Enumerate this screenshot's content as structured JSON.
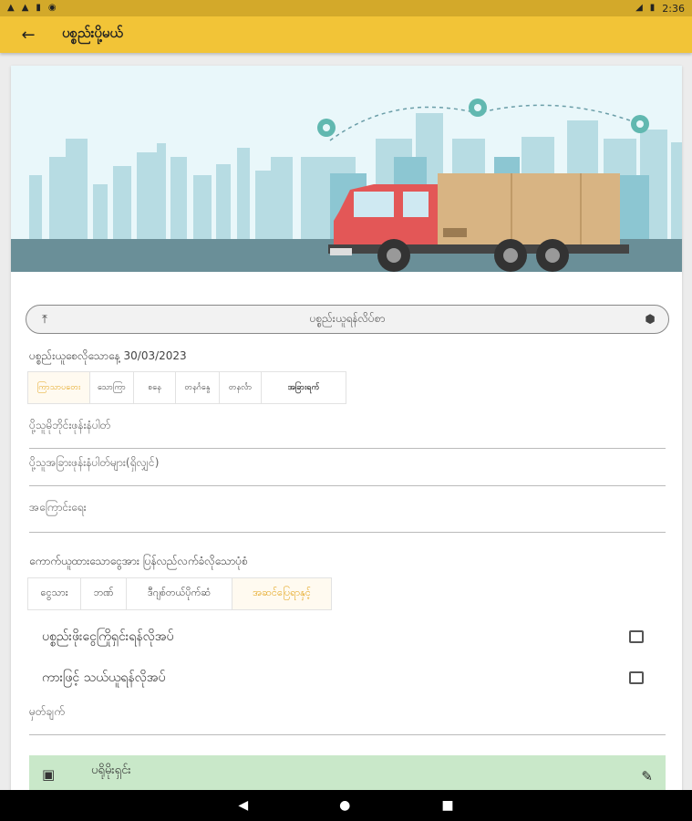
{
  "status_bar": {
    "time": "2:36"
  },
  "app_bar": {
    "title": "ပစ္စည်းပို့မယ်"
  },
  "upload": {
    "label": "ပစ္စည်းယူရန်လိပ်စာ"
  },
  "pickup_date": {
    "label": "ပစ္စည်းယူစေလိုသောနေ့ 30/03/2023"
  },
  "day_options": [
    {
      "label": "ကြာသာပတေး",
      "active": true
    },
    {
      "label": "သောကြာ",
      "active": false
    },
    {
      "label": "စနေ",
      "active": false
    },
    {
      "label": "တနင်္ဂနွေ",
      "active": false
    },
    {
      "label": "တနင်္လာ",
      "active": false
    },
    {
      "label": "အခြားရက်",
      "active": false
    }
  ],
  "fields": {
    "receiver_phone": "ပို့သူမိုဘိုင်းဖုန်းနံပါတ်",
    "other_phone": "ပို့သူအခြားဖုန်းနံပါတ်များ(ရှိလျှင်)",
    "reason": "အကြောင်းရေး",
    "remark": "မှတ်ချက်"
  },
  "payment": {
    "label": "ကောက်ယူထားသောငွေအား ပြန်လည်လက်ခံလိုသောပုံစံ",
    "options": [
      {
        "label": "ငွေသား",
        "active": false
      },
      {
        "label": "ဘဏ်",
        "active": false
      },
      {
        "label": "ဒီဂျစ်တယ်ပိုက်ဆံ",
        "active": false
      },
      {
        "label": "အဆင်ပြေရာနှင့်",
        "active": true
      }
    ]
  },
  "checks": {
    "collect_money": "ပစ္စည်းဖိုးငွေကြိုရှင်းရန်လိုအပ်",
    "by_car": "ကားဖြင့် သယ်ယူရန်လိုအပ်"
  },
  "receiver": {
    "label": "ပရိုမိုးရှင်း"
  },
  "colors": {
    "app_bar": "#f2c437",
    "status_bar": "#d3a92a",
    "accent": "#e3a41b",
    "receiver_bg": "#c9e8c9"
  }
}
